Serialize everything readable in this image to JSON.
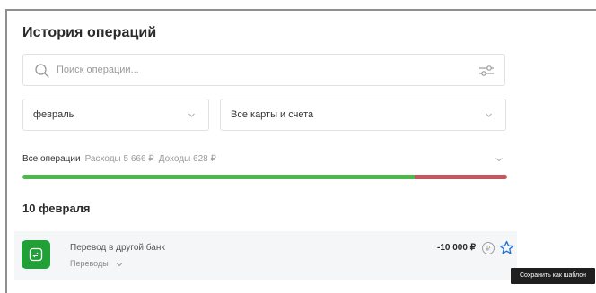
{
  "page": {
    "title": "История операций"
  },
  "search": {
    "placeholder": "Поиск операции...",
    "icon": "search-icon",
    "filter_icon": "filter-sliders-icon"
  },
  "filters": {
    "period": {
      "value": "февраль",
      "icon": "chevron-down-icon"
    },
    "accounts": {
      "value": "Все карты и счета",
      "icon": "chevron-down-icon"
    }
  },
  "summary": {
    "all_label": "Все операции",
    "expenses_label": "Расходы 5 666 ₽",
    "income_label": "Доходы 628 ₽",
    "expenses": 5666,
    "income": 628,
    "currency": "₽",
    "income_share": 0.81,
    "expense_share": 0.19
  },
  "day_group": {
    "date": "10 февраля",
    "operations": [
      {
        "name": "Перевод в другой банк",
        "category": "Переводы",
        "amount": "-10 000 ₽",
        "icon": "transfer-icon"
      }
    ]
  },
  "tooltip": {
    "text": "Сохранить как шаблон"
  },
  "colors": {
    "accent_green": "#21a038",
    "bar_green": "#4cb94a",
    "bar_red": "#c5555e",
    "star_blue": "#1f6fd6",
    "muted_text": "#9a9a9a"
  }
}
